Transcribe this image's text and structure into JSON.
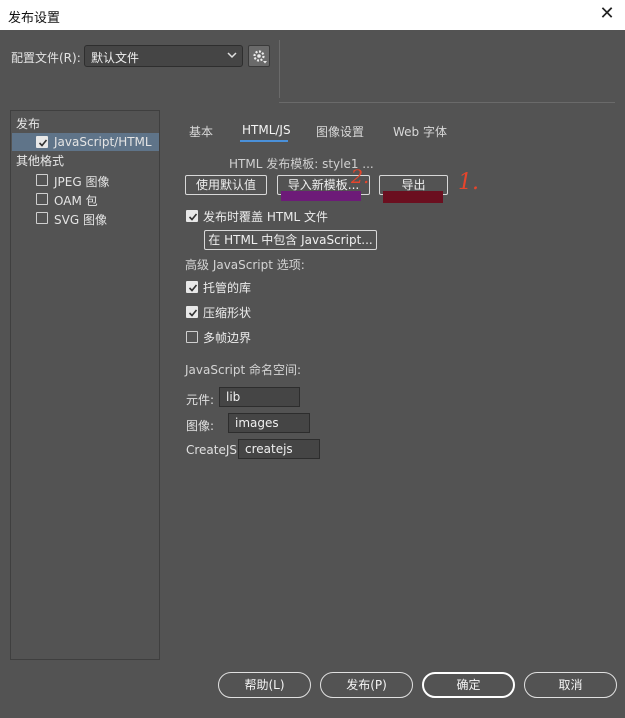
{
  "window": {
    "title": "发布设置",
    "close_symbol": "✕"
  },
  "profile": {
    "label": "配置文件(R):",
    "value": "默认文件"
  },
  "sidebar": {
    "group1": "发布",
    "items1": [
      {
        "label": "JavaScript/HTML",
        "checked": true,
        "selected": true
      }
    ],
    "group2": "其他格式",
    "items2": [
      {
        "label": "JPEG 图像",
        "checked": false
      },
      {
        "label": "OAM 包",
        "checked": false
      },
      {
        "label": "SVG 图像",
        "checked": false
      }
    ]
  },
  "tabs": [
    {
      "label": "基本"
    },
    {
      "label": "HTML/JS",
      "active": true
    },
    {
      "label": "图像设置"
    },
    {
      "label": "Web 字体"
    }
  ],
  "html_js": {
    "template_label": "HTML 发布模板: style1 ...",
    "use_default": "使用默认值",
    "import_template": "导入新模板...",
    "export": "导出",
    "overwrite_label": "发布时覆盖 HTML 文件",
    "include_js": "在 HTML 中包含 JavaScript...",
    "advanced_label": "高级 JavaScript 选项:",
    "hosted_libs": "托管的库",
    "compact_shapes": "压缩形状",
    "multiframe_bounds": "多帧边界",
    "namespace_label": "JavaScript 命名空间:",
    "symbols_label": "元件:",
    "symbols_value": "lib",
    "images_label": "图像:",
    "images_value": "images",
    "createjs_label": "CreateJS:",
    "createjs_value": "createjs"
  },
  "annotations": {
    "one": "1.",
    "two": "2."
  },
  "footer": {
    "help": "帮助(L)",
    "publish": "发布(P)",
    "ok": "确定",
    "cancel": "取消"
  },
  "colors": {
    "accent_underline": "#4a90d9",
    "annotation_red": "#e6452c",
    "mark_purple": "#6d1b78",
    "mark_maroon": "#6b0f1f"
  }
}
